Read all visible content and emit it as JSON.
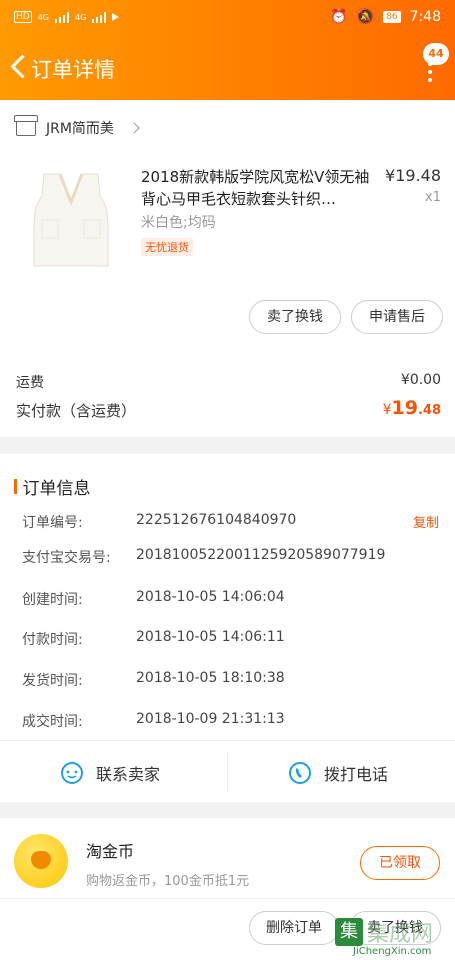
{
  "status_bar": {
    "network": "HD",
    "signal1": "4G",
    "signal2": "4G",
    "battery": "86",
    "time": "7:48"
  },
  "nav": {
    "title": "订单详情",
    "badge": "44"
  },
  "store": {
    "name": "JRM简而美"
  },
  "product": {
    "title": "2018新款韩版学院风宽松V领无袖背心马甲毛衣短款套头针织…",
    "price": "¥19.48",
    "qty": "x1",
    "sku": "米白色;均码",
    "tag": "无忧退货",
    "btn_sell": "卖了换钱",
    "btn_after_sale": "申请售后"
  },
  "fees": {
    "shipping_label": "运费",
    "shipping_value": "¥0.00",
    "total_label": "实付款（含运费）",
    "total_currency": "¥",
    "total_int": "19",
    "total_dec": ".48"
  },
  "order_info": {
    "title": "订单信息",
    "copy_label": "复制",
    "rows": [
      {
        "label": "订单编号:",
        "value": "222512676104840970"
      },
      {
        "label": "支付宝交易号:",
        "value": "2018100522001125920589077919"
      },
      {
        "label": "创建时间:",
        "value": "2018-10-05 14:06:04"
      },
      {
        "label": "付款时间:",
        "value": "2018-10-05 14:06:11"
      },
      {
        "label": "发货时间:",
        "value": "2018-10-05 18:10:38"
      },
      {
        "label": "成交时间:",
        "value": "2018-10-09 21:31:13"
      }
    ],
    "contact_label": "联系卖家",
    "call_label": "拨打电话"
  },
  "coins": {
    "title": "淘金币",
    "subtitle": "购物返金币，100金币抵1元",
    "button": "已领取"
  },
  "bottom": {
    "delete_label": "删除订单",
    "sell_label": "卖了换钱"
  },
  "watermark": {
    "text": "集成网",
    "url": "JiChengXin.com"
  },
  "colors": {
    "accent": "#ff6a00",
    "price": "#ff5000",
    "link_blue": "#1e9fe0"
  }
}
